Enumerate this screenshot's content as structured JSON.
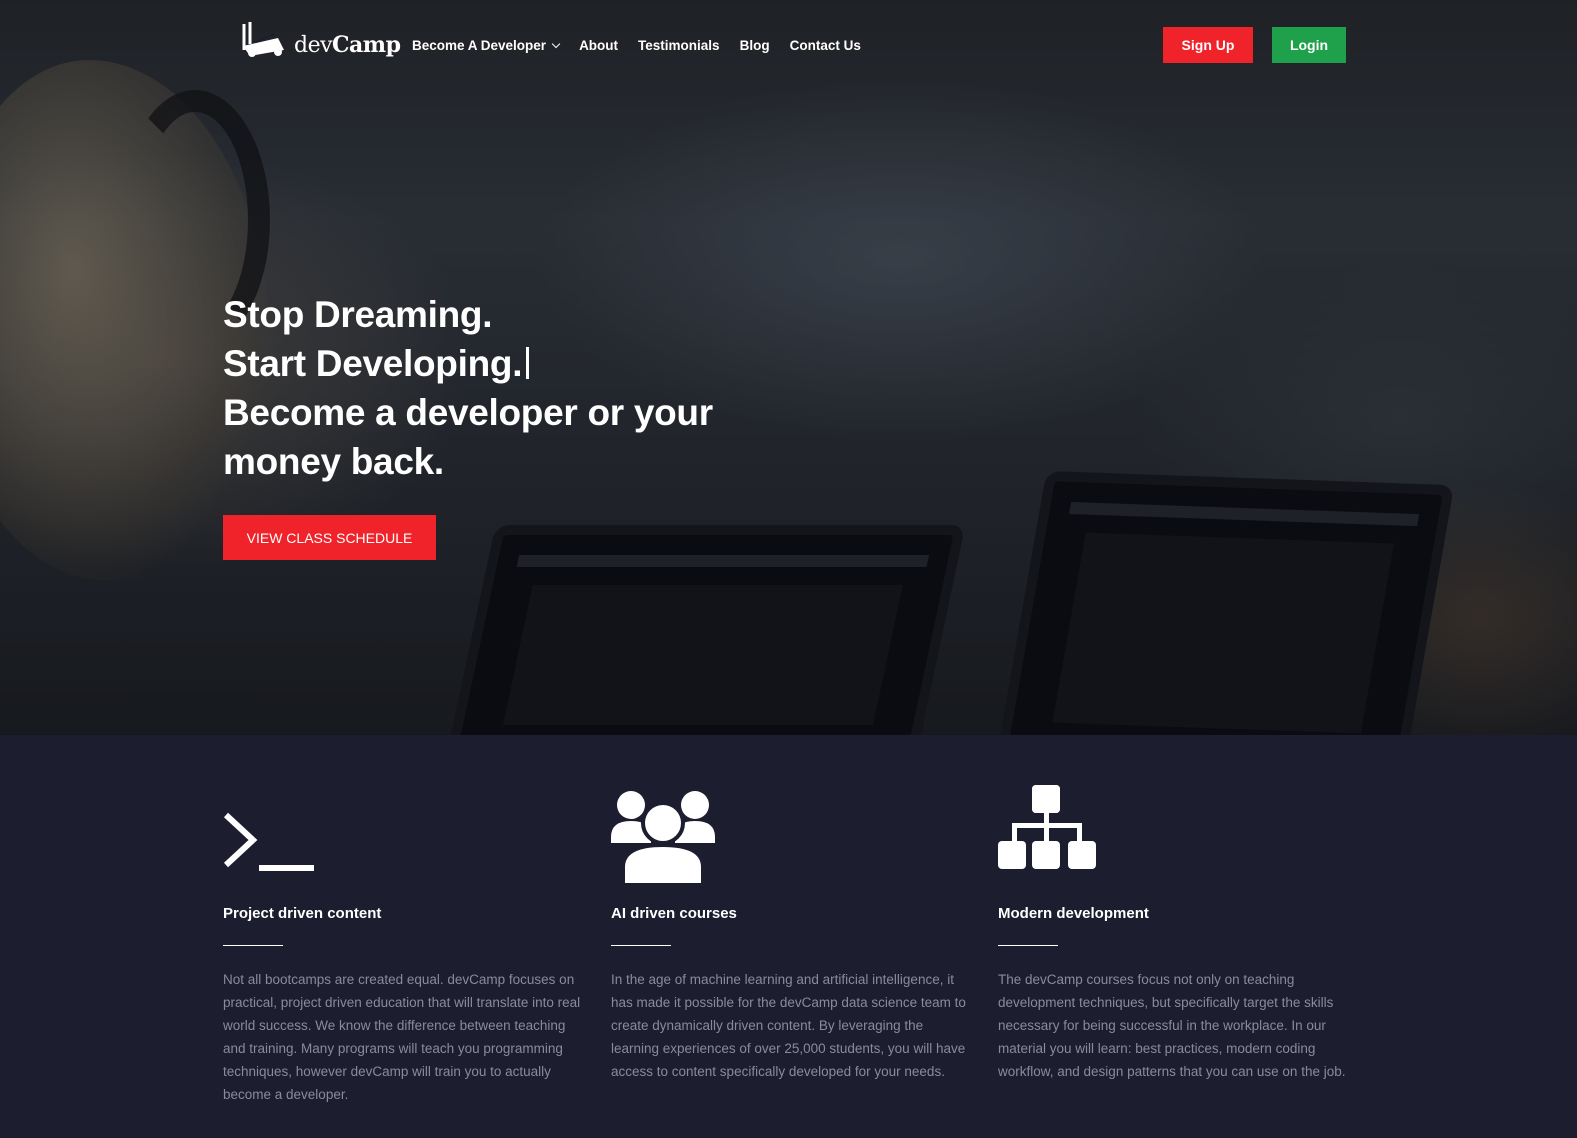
{
  "brand": {
    "logo_text_light": "dev",
    "logo_text_bold": "Camp"
  },
  "nav": {
    "items": [
      {
        "label": "Become A Developer",
        "has_dropdown": true
      },
      {
        "label": "About"
      },
      {
        "label": "Testimonials"
      },
      {
        "label": "Blog"
      },
      {
        "label": "Contact Us"
      }
    ]
  },
  "auth": {
    "signup_label": "Sign Up",
    "login_label": "Login"
  },
  "hero": {
    "lines": [
      "Stop Dreaming.",
      "Start Developing.",
      "Become a developer or your",
      "money back."
    ],
    "cta_label": "VIEW CLASS SCHEDULE"
  },
  "features": [
    {
      "icon": "terminal-icon",
      "title": "Project driven content",
      "text": "Not all bootcamps are created equal. devCamp focuses on practical, project driven education that will translate into real world success. We know the difference between teaching and training. Many programs will teach you programming techniques, however devCamp will train you to actually become a developer."
    },
    {
      "icon": "users-icon",
      "title": "AI driven courses",
      "text": "In the age of machine learning and artificial intelligence, it has made it possible for the devCamp data science team to create dynamically driven content. By leveraging the learning experiences of over 25,000 students, you will have access to content specifically developed for your needs."
    },
    {
      "icon": "sitemap-icon",
      "title": "Modern development",
      "text": "The devCamp courses focus not only on teaching development techniques, but specifically target the skills necessary for being successful in the workplace. In our material you will learn: best practices, modern coding workflow, and design patterns that you can use on the job."
    }
  ],
  "colors": {
    "accent_red": "#f0222a",
    "login_green": "#1fa04a",
    "section_bg": "#1c1d2f",
    "body_text": "#8a8b9a"
  }
}
